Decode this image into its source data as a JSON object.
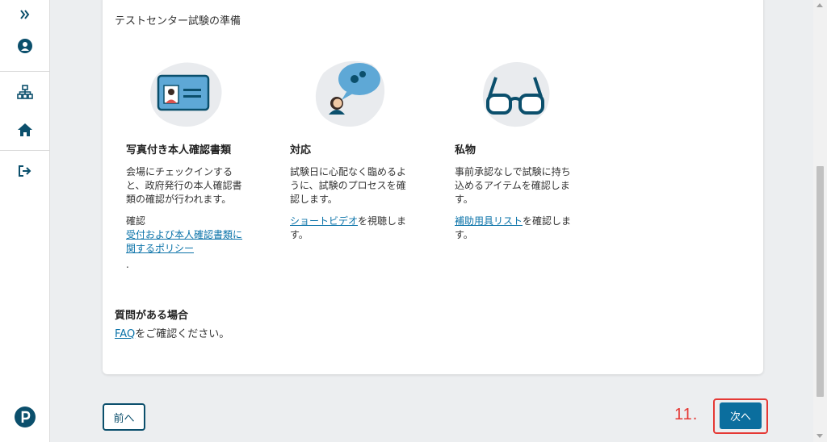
{
  "sidebar": {
    "items": [
      {
        "icon": "expand-chevrons-icon"
      },
      {
        "icon": "user-icon"
      },
      {
        "icon": "sitemap-icon"
      },
      {
        "icon": "home-icon"
      },
      {
        "icon": "sign-out-icon"
      },
      {
        "icon": "pearson-logo"
      }
    ],
    "accent": "#0b4f6c"
  },
  "card": {
    "heading": "テストセンター試験の準備",
    "columns": [
      {
        "title": "写真付き本人確認書類",
        "text": "会場にチェックインすると、政府発行の本人確認書類の確認が行われます。",
        "label": "確認",
        "link": "受付および本人確認書類に関するポリシー",
        "after": "."
      },
      {
        "title": "対応",
        "text": "試験日に心配なく臨めるように、試験のプロセスを確認します。",
        "link": "ショートビデオ",
        "after": "を視聴します。"
      },
      {
        "title": "私物",
        "text": "事前承認なしで試験に持ち込めるアイテムを確認します。",
        "link": "補助用具リスト",
        "after": "を確認します。"
      }
    ],
    "questions": {
      "title": "質問がある場合",
      "link": "FAQ",
      "after": "をご確認ください。"
    }
  },
  "nav": {
    "prev_label": "前へ",
    "next_label": "次へ",
    "step_label": "11."
  },
  "colors": {
    "link": "#0b73a9",
    "next_button": "#0b6e9e",
    "highlight": "#e53935"
  }
}
